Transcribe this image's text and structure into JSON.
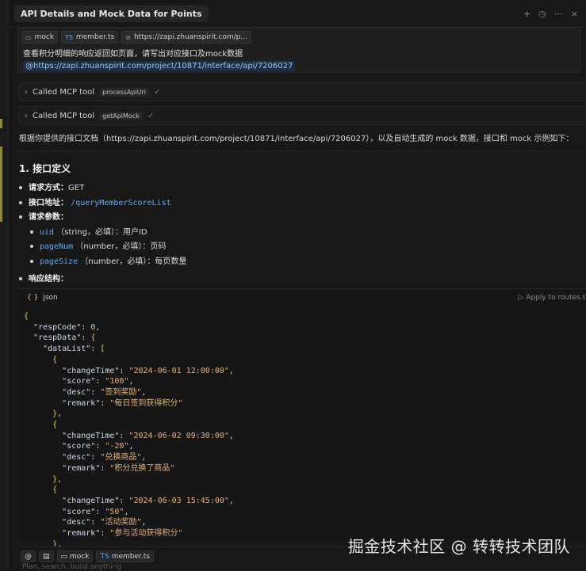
{
  "panel": {
    "title": "API Details and Mock Data for Points",
    "icons": [
      "plus-icon",
      "history-icon",
      "more-icon",
      "close-icon"
    ]
  },
  "message": {
    "chips": [
      {
        "icon": "folder-icon",
        "label": "mock"
      },
      {
        "icon": "ts-file-icon",
        "label": "member.ts"
      },
      {
        "icon": "link-icon",
        "label": "https://zapi.zhuanspirit.com/p..."
      }
    ],
    "text": "查看积分明细的响应返回如页面，请写出对应接口及mock数据",
    "link": "@https://zapi.zhuanspirit.com/project/10871/interface/api/7206027"
  },
  "tools": [
    {
      "label": "Called MCP tool",
      "name": "processApiUrl"
    },
    {
      "label": "Called MCP tool",
      "name": "getApiMock"
    }
  ],
  "intro": "根据你提供的接口文档（https://zapi.zhuanspirit.com/project/10871/interface/api/7206027），以及自动生成的 mock 数据，接口和 mock 示例如下：",
  "section": {
    "heading": "1. 接口定义",
    "method_label": "请求方式",
    "method_value": "GET",
    "url_label": "接口地址",
    "url_value": "/queryMemberScoreList",
    "params_label": "请求参数",
    "params": [
      {
        "name": "uid",
        "desc": "（string，必填）：用户ID"
      },
      {
        "name": "pageNum",
        "desc": "（number，必填）：页码"
      },
      {
        "name": "pageSize",
        "desc": "（number，必填）：每页数量"
      }
    ],
    "response_label": "响应结构"
  },
  "codeblock": {
    "lang": "json",
    "apply": "Apply to routes.ts",
    "respCode": 0,
    "items": [
      {
        "changeTime": "2024-06-01 12:00:00",
        "score": "100",
        "desc": "签到奖励",
        "remark": "每日签到获得积分"
      },
      {
        "changeTime": "2024-06-02 09:30:00",
        "score": "-20",
        "desc": "兑换商品",
        "remark": "积分兑换了商品"
      },
      {
        "changeTime": "2024-06-03 15:45:00",
        "score": "50",
        "desc": "活动奖励",
        "remark": "参与活动获得积分"
      }
    ]
  },
  "composer": {
    "chips": [
      "mock",
      "member.ts"
    ],
    "placeholder": "Plan, search, build anything"
  },
  "watermark": "掘金技术社区 @ 转转技术团队"
}
